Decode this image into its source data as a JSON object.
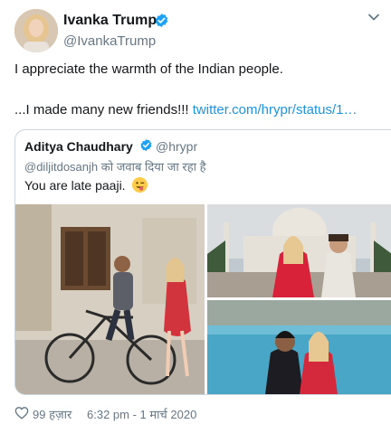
{
  "tweet": {
    "author_name": "Ivanka Trump",
    "author_handle": "@IvankaTrump",
    "line1": "I appreciate the warmth of the Indian people.",
    "line2_text": "...I made many new friends!!! ",
    "line2_link": "twitter.com/hrypr/status/1…"
  },
  "quoted": {
    "author_name": "Aditya Chaudhary",
    "author_handle": "@hrypr",
    "reply_line": "@diljitdosanjh को जवाब दिया जा रहा है",
    "text": "You are late paaji."
  },
  "footer": {
    "likes": "99 हज़ार",
    "timestamp": "6:32 pm - 1 मार्च 2020"
  },
  "colors": {
    "link": "#1b95e0",
    "verified": "#1da1f2",
    "secondary_text": "#657786",
    "border": "#ccd6dd"
  },
  "icons": {
    "verified": "verified-badge-icon",
    "chevron": "chevron-down-icon",
    "heart": "heart-icon",
    "emoji": "winking-face-tongue-icon"
  }
}
